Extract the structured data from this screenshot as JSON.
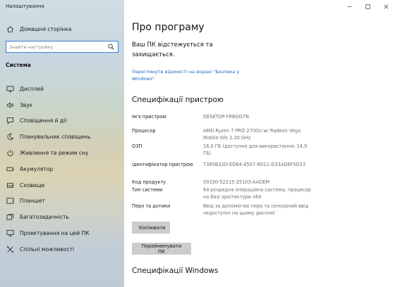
{
  "window": {
    "title": "Налаштування"
  },
  "sidebar": {
    "home_label": "Домашня сторінка",
    "search": {
      "placeholder": "Знайти настройку"
    },
    "section_heading": "Система",
    "items": [
      {
        "label": "Дисплей",
        "icon": "display-icon"
      },
      {
        "label": "Звук",
        "icon": "sound-icon"
      },
      {
        "label": "Сповіщення й дії",
        "icon": "notifications-icon"
      },
      {
        "label": "Планувальник сповіщень",
        "icon": "moon-icon"
      },
      {
        "label": "Живлення та режим сну",
        "icon": "power-icon"
      },
      {
        "label": "Акумулятор",
        "icon": "battery-icon"
      },
      {
        "label": "Сховище",
        "icon": "storage-icon"
      },
      {
        "label": "Планшет",
        "icon": "tablet-icon"
      },
      {
        "label": "Багатозадачність",
        "icon": "multitasking-icon"
      },
      {
        "label": "Проектування на цей ПК",
        "icon": "projecting-icon"
      },
      {
        "label": "Спільні можливості",
        "icon": "shared-experiences-icon"
      }
    ]
  },
  "main": {
    "title": "Про програму",
    "protect_text": "Ваш ПК відстежується та захищається.",
    "security_link": "Переглянути відомості на екрані \"Безпека у Windows\"",
    "device_specs_title": "Специфікації пристрою",
    "specs": [
      {
        "label": "Ім'я пристрою",
        "value": "DESKTOP-FRBOG7N"
      },
      {
        "label": "Процесор",
        "value": "AMD Ryzen 7 PRO 2700U w/ Radeon Vega Mobile Gfx     2.20 GHz"
      },
      {
        "label": "ОЗП",
        "value": "16,0 ГБ (доступно для використання: 14,9 ГБ)"
      },
      {
        "label": "Ідентифікатор пристрою",
        "value": "7395B32D-ED64-4507-8D11-D33AD6F5D23"
      },
      {
        "label": "Код продукту",
        "value": "00330-52215-25103-AAOEM"
      },
      {
        "label": "Тип системи",
        "value": "64-розрядна операційна система, процесор на базі архітектури x64"
      },
      {
        "label": "Перо та дотики",
        "value": "Ввід за допомогою пера та сенсорний ввід недоступні на цьому дисплеї"
      }
    ],
    "copy_button": "Копіювати",
    "rename_button": "Перейменувати ПК",
    "windows_specs_title": "Специфікації Windows"
  }
}
